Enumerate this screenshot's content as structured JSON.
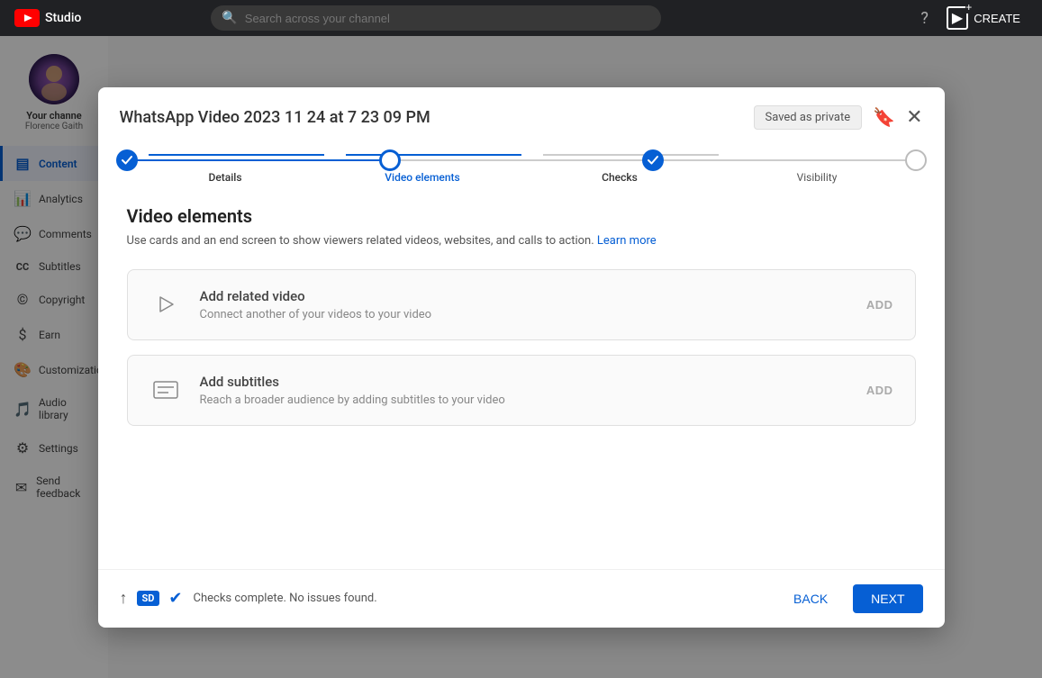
{
  "topbar": {
    "logo_text": "Studio",
    "search_placeholder": "Search across your channel",
    "create_label": "CREATE"
  },
  "sidebar": {
    "channel_name": "Your channe",
    "channel_sub": "Florence Gaith",
    "items": [
      {
        "id": "content",
        "label": "Content",
        "icon": "▤",
        "active": true
      },
      {
        "id": "analytics",
        "label": "Analytics",
        "icon": "📊",
        "active": false
      },
      {
        "id": "comments",
        "label": "Comments",
        "icon": "💬",
        "active": false
      },
      {
        "id": "subtitles",
        "label": "Subtitles",
        "icon": "CC",
        "active": false
      },
      {
        "id": "copyright",
        "label": "Copyright",
        "icon": "©",
        "active": false
      },
      {
        "id": "earn",
        "label": "Earn",
        "icon": "$",
        "active": false
      },
      {
        "id": "customization",
        "label": "Customization",
        "icon": "🎨",
        "active": false
      },
      {
        "id": "audio",
        "label": "Audio library",
        "icon": "🎵",
        "active": false
      },
      {
        "id": "settings",
        "label": "Settings",
        "icon": "⚙",
        "active": false
      },
      {
        "id": "feedback",
        "label": "Send feedback",
        "icon": "✉",
        "active": false
      }
    ]
  },
  "modal": {
    "title": "WhatsApp Video 2023 11 24 at 7 23 09 PM",
    "saved_label": "Saved as private",
    "steps": [
      {
        "id": "details",
        "label": "Details",
        "state": "completed"
      },
      {
        "id": "video_elements",
        "label": "Video elements",
        "state": "current"
      },
      {
        "id": "checks",
        "label": "Checks",
        "state": "completed"
      },
      {
        "id": "visibility",
        "label": "Visibility",
        "state": "pending"
      }
    ],
    "section_title": "Video elements",
    "section_desc": "Use cards and an end screen to show viewers related videos, websites, and calls to action.",
    "learn_more_label": "Learn more",
    "elements": [
      {
        "id": "related_video",
        "title": "Add related video",
        "desc": "Connect another of your videos to your video",
        "icon_type": "play",
        "add_label": "ADD"
      },
      {
        "id": "subtitles",
        "title": "Add subtitles",
        "desc": "Reach a broader audience by adding subtitles to your video",
        "icon_type": "subtitles",
        "add_label": "ADD"
      }
    ],
    "footer": {
      "upload_icon": "↑",
      "hd_badge": "SD",
      "status_text": "Checks complete. No issues found.",
      "back_label": "BACK",
      "next_label": "NEXT"
    }
  }
}
